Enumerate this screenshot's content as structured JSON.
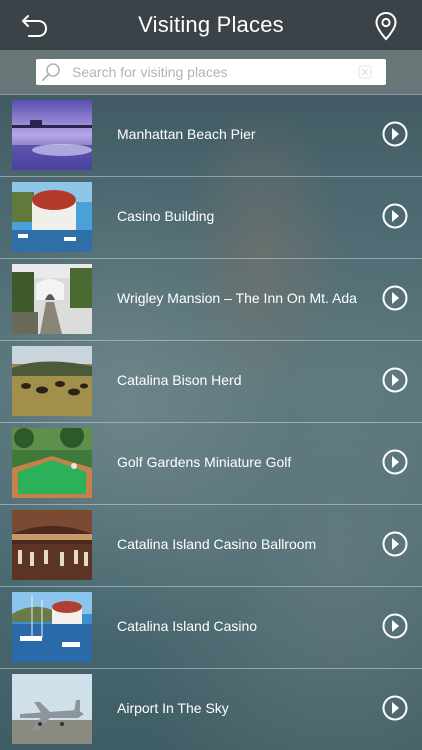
{
  "header": {
    "title": "Visiting Places",
    "back_icon": "back-arrow-icon",
    "location_icon": "location-pin-icon"
  },
  "search": {
    "placeholder": "Search for visiting places",
    "value": ""
  },
  "places": [
    {
      "name": "Manhattan Beach Pier"
    },
    {
      "name": "Casino Building"
    },
    {
      "name": "Wrigley Mansion – The Inn On Mt. Ada"
    },
    {
      "name": "Catalina Bison Herd"
    },
    {
      "name": "Golf Gardens Miniature Golf"
    },
    {
      "name": "Catalina Island Casino Ballroom"
    },
    {
      "name": "Catalina Island Casino"
    },
    {
      "name": "Airport In The Sky"
    }
  ],
  "colors": {
    "header_bg": "#3c4246",
    "text": "#ffffff",
    "divider": "#dcebf0"
  }
}
